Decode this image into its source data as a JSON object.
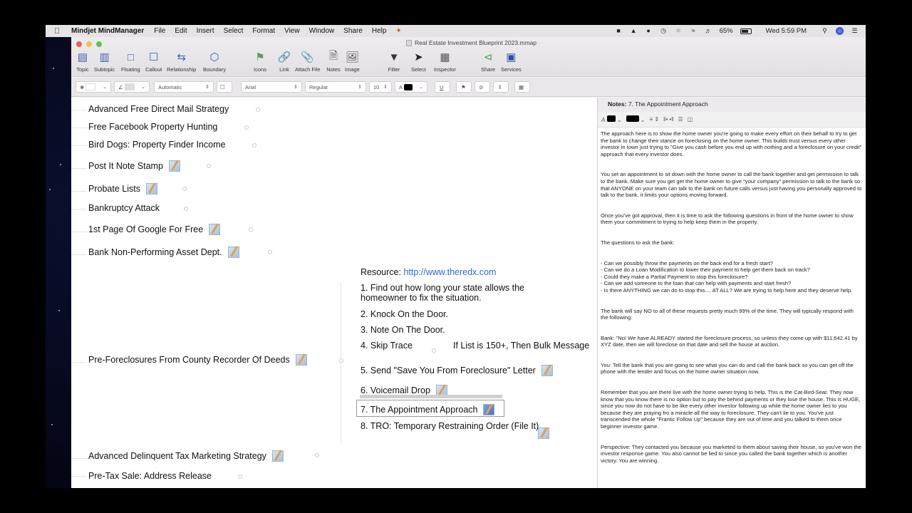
{
  "menubar": {
    "app_name": "Mindjet MindManager",
    "menus": [
      "File",
      "Edit",
      "Insert",
      "Select",
      "Format",
      "View",
      "Window",
      "Share",
      "Help"
    ],
    "battery": "65%",
    "clock": "Wed 5:59 PM"
  },
  "window": {
    "title": "Real Estate Investment Blueprint 2023.mmap"
  },
  "toolbar": {
    "tools": [
      {
        "label": "Topic",
        "icon": "topic-icon"
      },
      {
        "label": "Subtopic",
        "icon": "subtopic-icon"
      },
      {
        "label": "Floating",
        "icon": "floating-icon"
      },
      {
        "label": "Callout",
        "icon": "callout-icon"
      },
      {
        "label": "Relationship",
        "icon": "relationship-icon"
      },
      {
        "label": "Boundary",
        "icon": "boundary-icon"
      },
      {
        "label": "Icons",
        "icon": "icons-icon"
      },
      {
        "label": "Link",
        "icon": "link-icon"
      },
      {
        "label": "Attach File",
        "icon": "paperclip-icon"
      },
      {
        "label": "Notes",
        "icon": "notes-icon"
      },
      {
        "label": "Image",
        "icon": "image-icon"
      },
      {
        "label": "Filter",
        "icon": "filter-icon"
      },
      {
        "label": "Select",
        "icon": "pointer-icon"
      },
      {
        "label": "Inspector",
        "icon": "inspector-icon"
      },
      {
        "label": "Share",
        "icon": "share-icon"
      },
      {
        "label": "Services",
        "icon": "services-icon"
      }
    ]
  },
  "formatbar": {
    "line_style": "Automatic",
    "font": "Arial",
    "weight": "Regular",
    "size": "10",
    "text_color": "#000000"
  },
  "map": {
    "topics_top": [
      {
        "label": "Advanced Free Direct Mail Strategy",
        "note": false
      },
      {
        "label": "Free Facebook Property Hunting",
        "note": false
      },
      {
        "label": "Bird Dogs: Property Finder Income",
        "note": false
      },
      {
        "label": "Post It Note Stamp",
        "note": true
      },
      {
        "label": "Probate Lists",
        "note": true
      },
      {
        "label": "Bankruptcy Attack",
        "note": false
      },
      {
        "label": "1st Page Of Google For Free",
        "note": true
      },
      {
        "label": "Bank Non-Performing Asset Dept.",
        "note": true
      }
    ],
    "main_topic": {
      "label": "Pre-Foreclosures From County Recorder Of Deeds",
      "note": true
    },
    "resource_label": "Resource:",
    "resource_link": "http://www.theredx.com",
    "subtopics": [
      {
        "label": "1. Find out how long your state allows the homeowner to fix the situation.",
        "note": false
      },
      {
        "label": "2. Knock On the Door.",
        "note": false
      },
      {
        "label": "3. Note On The Door.",
        "note": false
      },
      {
        "label": "4. Skip Trace",
        "note": false
      },
      {
        "label": "5. Send \"Save You From Foreclosure\" Letter",
        "note": true
      },
      {
        "label": "6. Voicemail Drop",
        "note": true
      },
      {
        "label": "7. The Appointment Approach",
        "note": true,
        "selected": true
      },
      {
        "label": "8. TRO: Temporary Restraining Order (File It)",
        "note": true
      }
    ],
    "skip_trace_child": "If List is 150+, Then Bulk Message",
    "topics_bottom": [
      {
        "label": "Advanced Delinquent Tax Marketing Strategy",
        "note": true
      },
      {
        "label": "Pre-Tax Sale: Address Release",
        "note": false
      }
    ]
  },
  "notes": {
    "header_label": "Notes:",
    "header_topic": "7. The Appointment Approach",
    "paragraphs": [
      "The approach here is to show the home owner you're going to make every effort on their behalf to try to get the bank to change their stance on foreclosing on the home owner. This builds trust versus every other investor in town just trying to \"Give you cash before you end up with nothing and a foreclosure on your credit\" approach that every investor does.",
      "You set an appointment to sit down with the home owner to call the bank together and get permission to talk to the bank. Make sure you get get the home owner to give \"your company\" permission to talk to the bank so that ANYONE on your team can talk to the bank on future calls versus just having you personally approved to talk to the bank. it limits your options moving forward.",
      "Once you've got approval, then it is time to ask the following questions in front of the home owner to show them your commitment to trying to help keep them in the property.",
      "The questions to ask the bank:"
    ],
    "questions": [
      "- Can we possibly throw the payments on the back end for a fresh start?",
      "- Can we do a Loan Modification  to lower their payment to help get them back on track?",
      "- Could they make a Partial Payment to stop this foreclosure?",
      "- Can we add someone to the loan that can help with payments and start fresh?",
      "- Is there ANYTHING we can do to stop this....  AT ALL? We are trying to help here and they deserve help."
    ],
    "paragraphs_after": [
      "The bank will say NO to all of these requests pretty much 99% of the time. They will typically respond with the following:",
      "Bank: \"No! We have ALREADY started the foreclosure process, so unless they come up with $11,642.41 by XYZ date, then we will foreclose on that date and sell the house at auction.",
      "You: Tell the bank that you are going to see what you can do and call the bank back so you can get off the phone with the lender and focus on the home owner situation now.",
      "Remember that you are there live with the home owner trying to help. This is the Cat-Bird-Seat. They now know that you know there is no option but to pay the behind payments or they lose the house. This is HUGE, since you now do not have to be like every other investor following up while the home owner lies to you because they are praying fro a miracle all the way to foreclosure. They can't lie to you. You've just transcended the whole \"Frantic Follow Up\" because they are out of time and you talked to them once beginner investor game.",
      "Perspective: They contacted you because you marketed to them about saving their house, so you've won the investor response game. You also cannot be lied to since you called the bank together which is another victory. You are winning."
    ]
  }
}
